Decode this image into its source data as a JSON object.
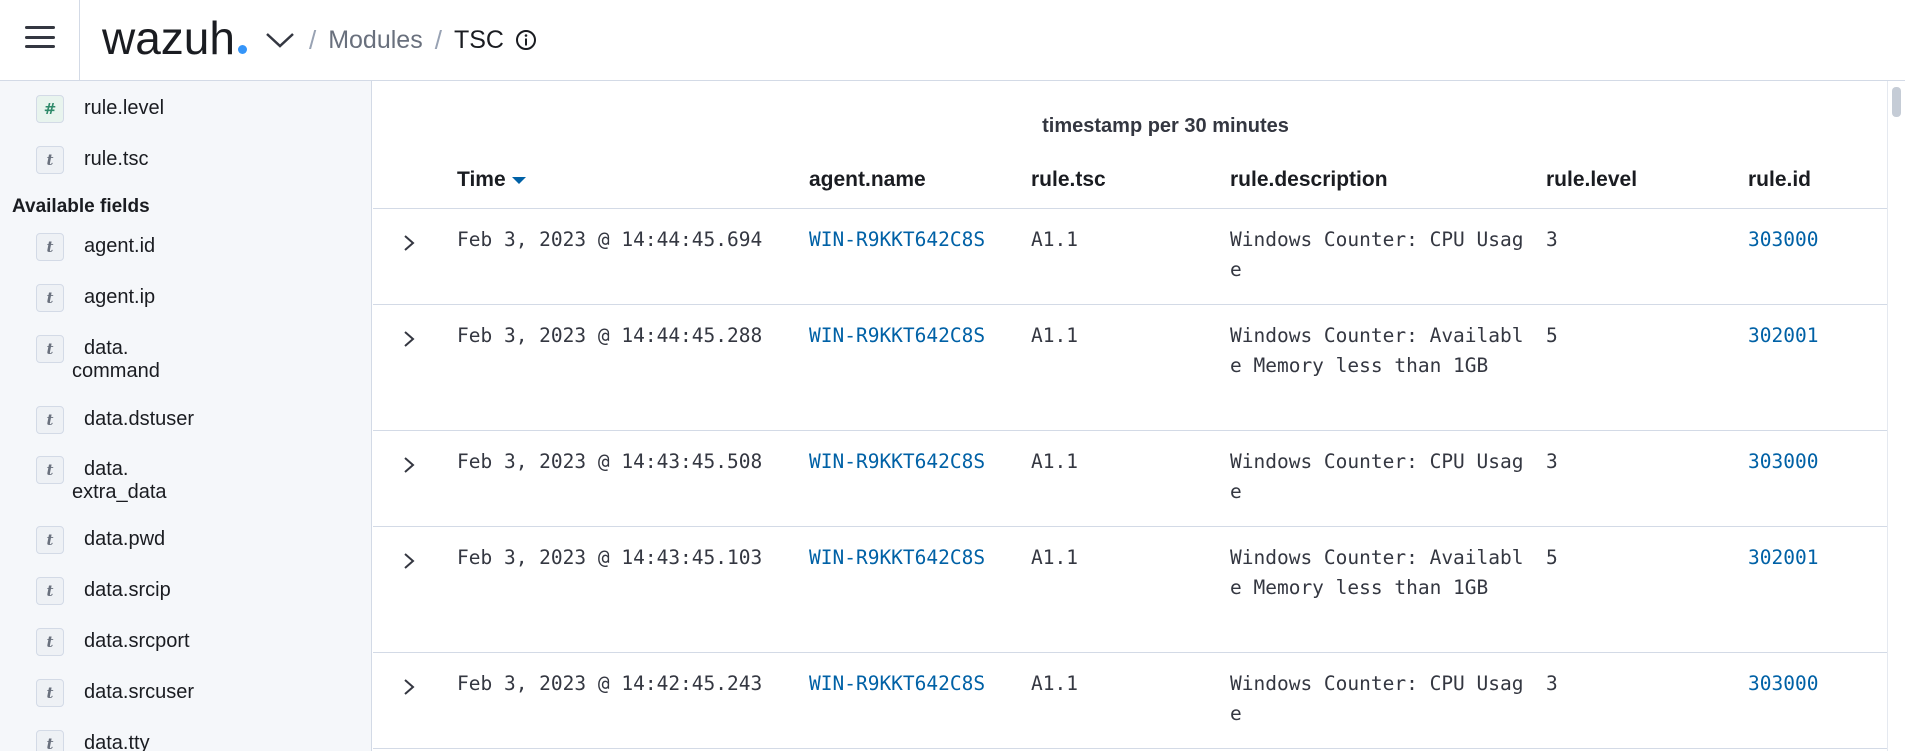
{
  "header": {
    "logo_text": "wazuh",
    "breadcrumb": [
      {
        "label": "Modules"
      },
      {
        "label": "TSC"
      }
    ]
  },
  "sidebar": {
    "selected_fields": [
      {
        "name": "rule.level",
        "type": "#"
      },
      {
        "name": "rule.tsc",
        "type": "t"
      }
    ],
    "available_title": "Available fields",
    "available_fields": [
      {
        "name": "agent.id",
        "type": "t"
      },
      {
        "name": "agent.ip",
        "type": "t"
      },
      {
        "name": "data.",
        "name2": "command",
        "type": "t"
      },
      {
        "name": "data.dstuser",
        "type": "t"
      },
      {
        "name": "data.",
        "name2": "extra_data",
        "type": "t"
      },
      {
        "name": "data.pwd",
        "type": "t"
      },
      {
        "name": "data.srcip",
        "type": "t"
      },
      {
        "name": "data.srcport",
        "type": "t"
      },
      {
        "name": "data.srcuser",
        "type": "t"
      },
      {
        "name": "data.tty",
        "type": "t"
      }
    ]
  },
  "table": {
    "histogram_title": "timestamp per 30 minutes",
    "columns": [
      "Time",
      "agent.name",
      "rule.tsc",
      "rule.description",
      "rule.level",
      "rule.id"
    ],
    "rows": [
      {
        "time": "Feb 3, 2023 @ 14:44:45.694",
        "agent": "WIN-R9KKT642C8S",
        "tsc": "A1.1",
        "desc": "Windows Counter: CPU Usage",
        "level": "3",
        "id": "303000"
      },
      {
        "time": "Feb 3, 2023 @ 14:44:45.288",
        "agent": "WIN-R9KKT642C8S",
        "tsc": "A1.1",
        "desc": "Windows Counter: Available Memory less than 1GB",
        "level": "5",
        "id": "302001"
      },
      {
        "time": "Feb 3, 2023 @ 14:43:45.508",
        "agent": "WIN-R9KKT642C8S",
        "tsc": "A1.1",
        "desc": "Windows Counter: CPU Usage",
        "level": "3",
        "id": "303000"
      },
      {
        "time": "Feb 3, 2023 @ 14:43:45.103",
        "agent": "WIN-R9KKT642C8S",
        "tsc": "A1.1",
        "desc": "Windows Counter: Available Memory less than 1GB",
        "level": "5",
        "id": "302001"
      },
      {
        "time": "Feb 3, 2023 @ 14:42:45.243",
        "agent": "WIN-R9KKT642C8S",
        "tsc": "A1.1",
        "desc": "Windows Counter: CPU Usage",
        "level": "3",
        "id": "303000"
      }
    ]
  },
  "colors": {
    "accent": "#0061a6",
    "logo_dot": "#3595f9",
    "sidebar_bg": "#f5f7fa",
    "border": "#d3dae6"
  }
}
